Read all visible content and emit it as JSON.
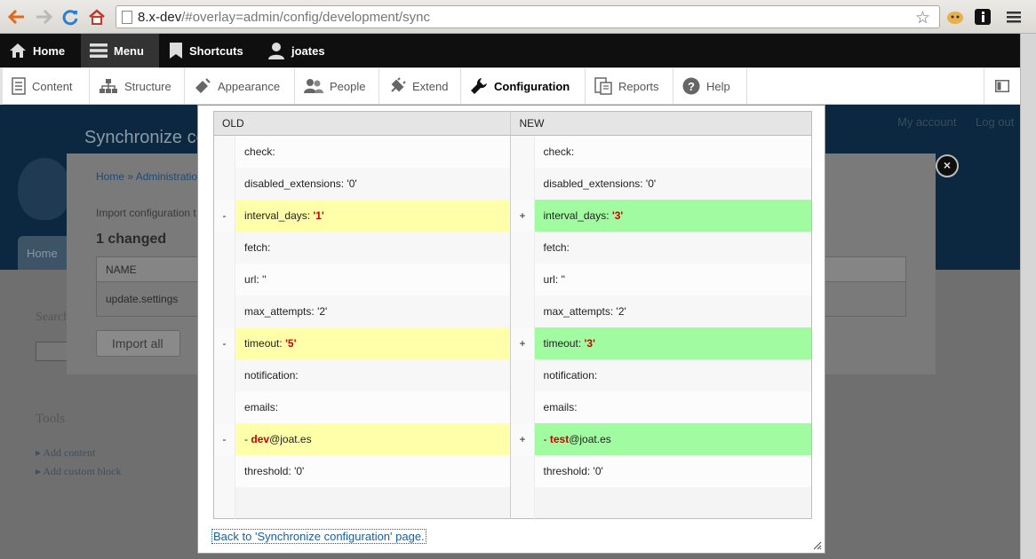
{
  "browser": {
    "url_host": "8.x-dev",
    "url_path": "/#overlay=admin/config/development/sync"
  },
  "toolbar": {
    "home": "Home",
    "menu": "Menu",
    "shortcuts": "Shortcuts",
    "user": "joates"
  },
  "tray": {
    "items": [
      "Content",
      "Structure",
      "Appearance",
      "People",
      "Extend",
      "Configuration",
      "Reports",
      "Help"
    ]
  },
  "background_page": {
    "title": "Synchronize co",
    "my_account": "My account",
    "log_out": "Log out",
    "tab_home": "Home",
    "breadcrumb": "Home » Administration",
    "intro": "Import configuration t",
    "changed_heading": "1 changed",
    "table_header": "NAME",
    "table_row": "update.settings",
    "import_button": "Import all",
    "search_label": "Search",
    "tools_heading": "Tools",
    "tool_links": [
      "Add content",
      "Add custom block"
    ]
  },
  "diff": {
    "old_header": "OLD",
    "new_header": "NEW",
    "rows": [
      {
        "type": "same",
        "old": "check:",
        "new": "check:"
      },
      {
        "type": "same",
        "old": "disabled_extensions: '0'",
        "new": "disabled_extensions: '0'"
      },
      {
        "type": "change",
        "old_prefix": "interval_days: ",
        "old_hl": "'1'",
        "old_suffix": "",
        "new_prefix": "interval_days: ",
        "new_hl": "'3'",
        "new_suffix": "",
        "old_marker": "-",
        "new_marker": "+"
      },
      {
        "type": "same",
        "old": "fetch:",
        "new": "fetch:"
      },
      {
        "type": "same",
        "old": "url: ''",
        "new": "url: ''"
      },
      {
        "type": "same",
        "old": "max_attempts: '2'",
        "new": "max_attempts: '2'"
      },
      {
        "type": "change",
        "old_prefix": "timeout: ",
        "old_hl": "'5'",
        "old_suffix": "",
        "new_prefix": "timeout: ",
        "new_hl": "'3'",
        "new_suffix": "",
        "old_marker": "-",
        "new_marker": "+"
      },
      {
        "type": "same",
        "old": "notification:",
        "new": "notification:"
      },
      {
        "type": "same",
        "old": "emails:",
        "new": "emails:"
      },
      {
        "type": "change",
        "old_prefix": "- ",
        "old_hl": "dev",
        "old_suffix": "@joat.es",
        "new_prefix": "- ",
        "new_hl": "test",
        "new_suffix": "@joat.es",
        "old_marker": "-",
        "new_marker": "+"
      },
      {
        "type": "same",
        "old": "threshold: '0'",
        "new": "threshold: '0'"
      },
      {
        "type": "same",
        "old": "",
        "new": ""
      }
    ]
  },
  "back_link": "Back to 'Synchronize configuration' page.",
  "close_label": "×"
}
